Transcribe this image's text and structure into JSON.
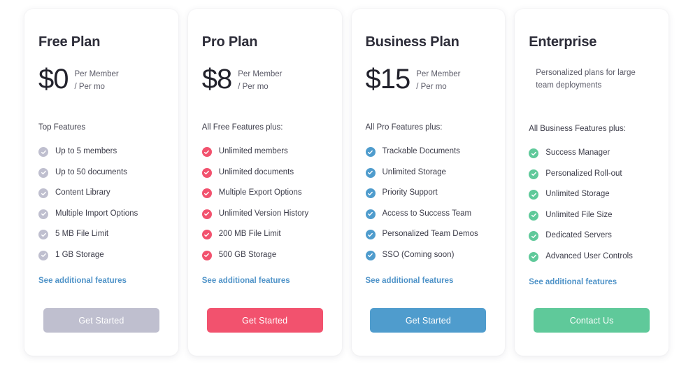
{
  "colors": {
    "page_background": "#ffffff",
    "card_background": "#ffffff",
    "title_text": "#2d2d39",
    "body_text": "#3d3d4a",
    "muted_text": "#5b5b68",
    "link_blue": "#4f93c8",
    "free_accent": "#bfbfcf",
    "pro_accent": "#f2526e",
    "business_accent": "#4f9ccd",
    "enterprise_accent": "#5fc99a"
  },
  "plans": [
    {
      "id": "free",
      "name": "Free Plan",
      "price": "$0",
      "price_unit_line1": "Per Member",
      "price_unit_line2": "/ Per mo",
      "description": "",
      "features_heading": "Top Features",
      "accent": "#bfbfcf",
      "check_icon": "check-circle-icon",
      "features": [
        "Up to 5 members",
        "Up to 50 documents",
        "Content Library",
        "Multiple Import Options",
        "5 MB File Limit",
        "1 GB Storage"
      ],
      "additional_link": "See additional features",
      "cta_label": "Get Started",
      "cta_color": "#bfbfcf"
    },
    {
      "id": "pro",
      "name": "Pro Plan",
      "price": "$8",
      "price_unit_line1": "Per Member",
      "price_unit_line2": "/ Per mo",
      "description": "",
      "features_heading": "All Free Features plus:",
      "accent": "#f2526e",
      "check_icon": "check-circle-icon",
      "features": [
        "Unlimited members",
        "Unlimited documents",
        "Multiple Export Options",
        "Unlimited Version History",
        "200 MB File Limit",
        "500 GB Storage"
      ],
      "additional_link": "See additional features",
      "cta_label": "Get Started",
      "cta_color": "#f2526e"
    },
    {
      "id": "business",
      "name": "Business Plan",
      "price": "$15",
      "price_unit_line1": "Per Member",
      "price_unit_line2": "/ Per mo",
      "description": "",
      "features_heading": "All Pro Features plus:",
      "accent": "#4f9ccd",
      "check_icon": "check-circle-icon",
      "features": [
        "Trackable Documents",
        "Unlimited Storage",
        "Priority Support",
        "Access to Success Team",
        "Personalized Team Demos",
        "SSO (Coming soon)"
      ],
      "additional_link": "See additional features",
      "cta_label": "Get Started",
      "cta_color": "#4f9ccd"
    },
    {
      "id": "enterprise",
      "name": "Enterprise",
      "price": "",
      "price_unit_line1": "",
      "price_unit_line2": "",
      "description": "Personalized plans for large team deployments",
      "features_heading": "All Business Features plus:",
      "accent": "#5fc99a",
      "check_icon": "check-circle-icon",
      "features": [
        "Success Manager",
        "Personalized Roll-out",
        "Unlimited Storage",
        "Unlimited File Size",
        "Dedicated Servers",
        "Advanced User Controls"
      ],
      "additional_link": "See additional features",
      "cta_label": "Contact Us",
      "cta_color": "#5fc99a"
    }
  ]
}
